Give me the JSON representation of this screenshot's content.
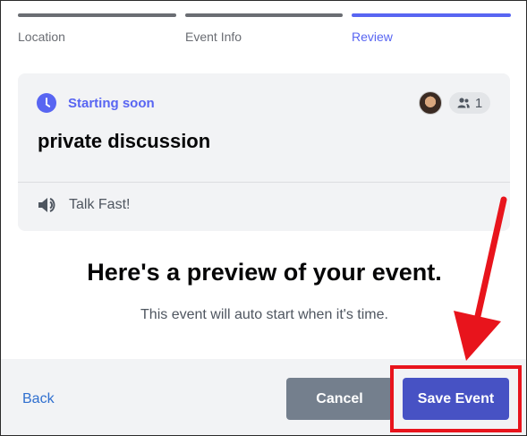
{
  "steps": [
    {
      "label": "Location",
      "state": "done"
    },
    {
      "label": "Event Info",
      "state": "done"
    },
    {
      "label": "Review",
      "state": "active"
    }
  ],
  "card": {
    "status": "Starting soon",
    "interested_count": "1",
    "title": "private discussion",
    "channel": "Talk Fast!"
  },
  "preview": {
    "title": "Here's a preview of your event.",
    "subtitle": "This event will auto start when it's time."
  },
  "footer": {
    "back_label": "Back",
    "cancel_label": "Cancel",
    "save_label": "Save Event"
  },
  "colors": {
    "accent": "#5865f2",
    "save_button": "#4752c4",
    "cancel_button": "#747f8d",
    "annotation": "#e8141c"
  },
  "icons": {
    "status": "clock-icon",
    "attendees": "people-icon",
    "channel": "stage-speaker-icon"
  }
}
